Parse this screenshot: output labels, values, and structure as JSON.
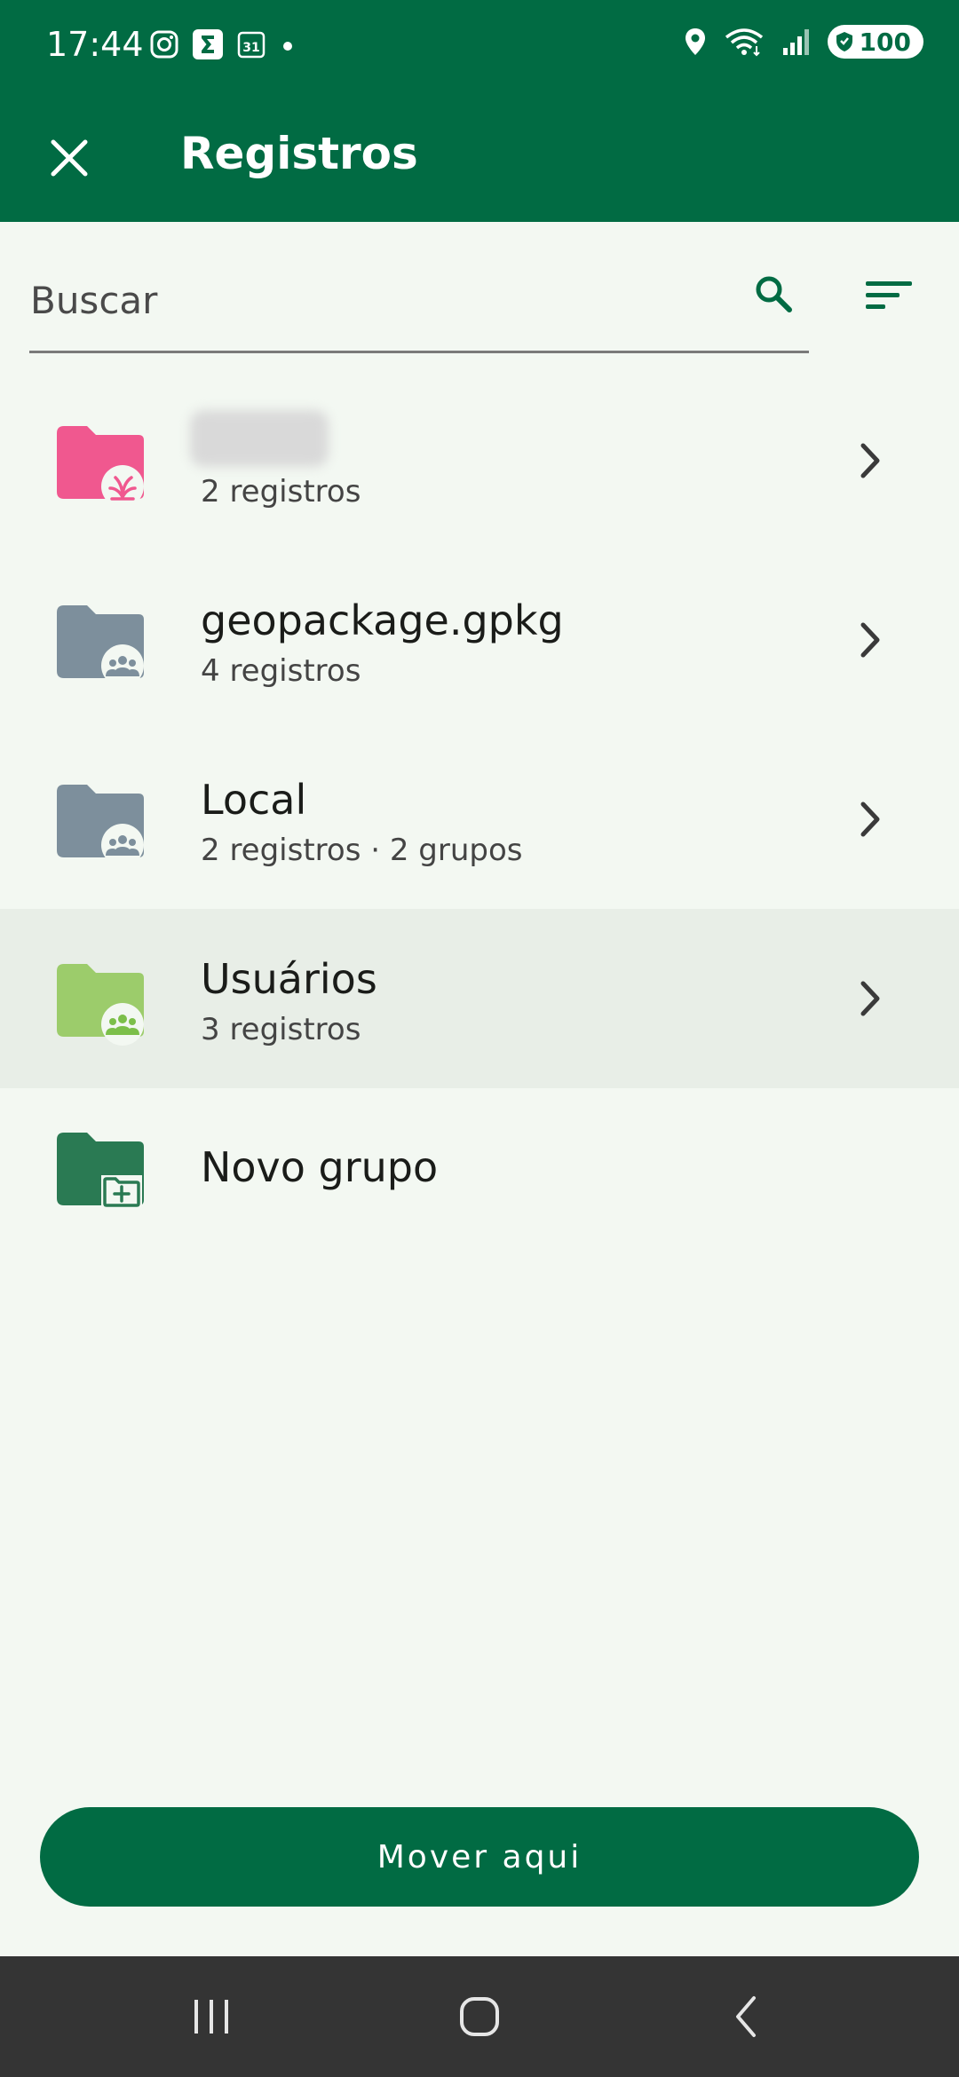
{
  "status_bar": {
    "time": "17:44",
    "battery": "100",
    "left_icons": [
      "instagram-icon",
      "sigma-app-icon",
      "calendar-icon",
      "dot-icon"
    ],
    "calendar_day": "31",
    "right_icons": [
      "location-icon",
      "wifi-icon",
      "signal-icon",
      "battery-icon"
    ]
  },
  "app_bar": {
    "title": "Registros",
    "close_icon": "close-icon"
  },
  "search": {
    "placeholder": "Buscar",
    "value": ""
  },
  "list": {
    "items": [
      {
        "name": "",
        "subtitle": "2 registros",
        "color": "#f0588f",
        "badge": "plant-icon",
        "blurred": true
      },
      {
        "name": "geopackage.gpkg",
        "subtitle": "4 registros",
        "color": "#7d8f9c",
        "badge": "group-icon"
      },
      {
        "name": "Local",
        "subtitle": "2 registros · 2 grupos",
        "color": "#7d8f9c",
        "badge": "group-icon"
      },
      {
        "name": "Usuários",
        "subtitle": "3 registros",
        "color": "#9ccc6b",
        "badge": "group-icon",
        "selected": true
      }
    ],
    "new_group_label": "Novo grupo"
  },
  "actions": {
    "move_here_label": "Mover aqui"
  },
  "colors": {
    "primary": "#016b43",
    "background": "#f3f8f2",
    "selected_row": "#e8eee7",
    "nav_bar": "#343434"
  }
}
